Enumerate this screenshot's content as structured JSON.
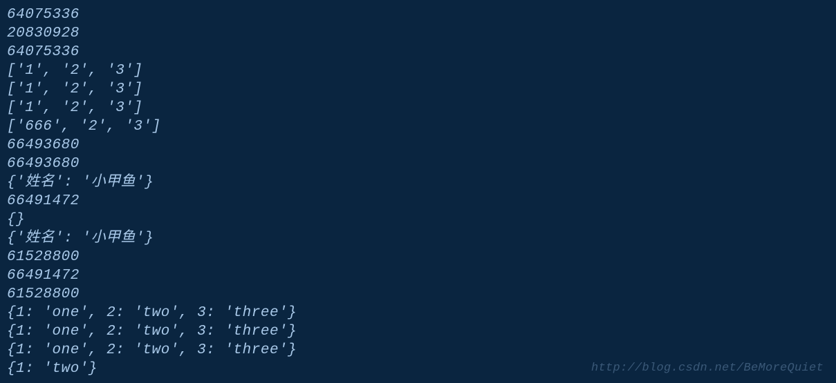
{
  "console": {
    "lines": [
      "64075336",
      "20830928",
      "64075336",
      "['1', '2', '3']",
      "['1', '2', '3']",
      "['1', '2', '3']",
      "['666', '2', '3']",
      "66493680",
      "66493680",
      "{'姓名': '小甲鱼'}",
      "66491472",
      "{}",
      "{'姓名': '小甲鱼'}",
      "61528800",
      "66491472",
      "61528800",
      "{1: 'one', 2: 'two', 3: 'three'}",
      "{1: 'one', 2: 'two', 3: 'three'}",
      "{1: 'one', 2: 'two', 3: 'three'}",
      "{1: 'two'}"
    ]
  },
  "watermark": {
    "text": "http://blog.csdn.net/BeMoreQuiet"
  }
}
